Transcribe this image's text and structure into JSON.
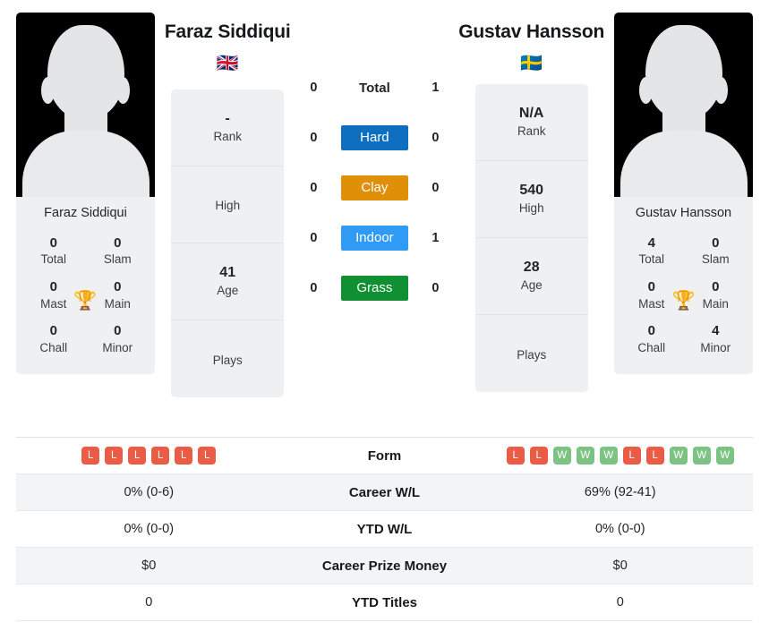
{
  "players": {
    "left": {
      "name": "Faraz Siddiqui",
      "flag": "🇬🇧",
      "photo_caption": "Faraz Siddiqui",
      "rank": "-",
      "rank_label": "Rank",
      "high": "",
      "high_label": "High",
      "age": "41",
      "age_label": "Age",
      "plays": "",
      "plays_label": "Plays",
      "titles": [
        {
          "value": "0",
          "label": "Total"
        },
        {
          "value": "0",
          "label": "Slam"
        },
        {
          "value": "0",
          "label": "Mast"
        },
        {
          "value": "0",
          "label": "Main"
        },
        {
          "value": "0",
          "label": "Chall"
        },
        {
          "value": "0",
          "label": "Minor"
        }
      ],
      "form": [
        "L",
        "L",
        "L",
        "L",
        "L",
        "L"
      ]
    },
    "right": {
      "name": "Gustav Hansson",
      "flag": "🇸🇪",
      "photo_caption": "Gustav Hansson",
      "rank": "N/A",
      "rank_label": "Rank",
      "high": "540",
      "high_label": "High",
      "age": "28",
      "age_label": "Age",
      "plays": "",
      "plays_label": "Plays",
      "titles": [
        {
          "value": "4",
          "label": "Total"
        },
        {
          "value": "0",
          "label": "Slam"
        },
        {
          "value": "0",
          "label": "Mast"
        },
        {
          "value": "0",
          "label": "Main"
        },
        {
          "value": "0",
          "label": "Chall"
        },
        {
          "value": "4",
          "label": "Minor"
        }
      ],
      "form": [
        "L",
        "L",
        "W",
        "W",
        "W",
        "L",
        "L",
        "W",
        "W",
        "W"
      ]
    }
  },
  "trophy_icon": "🏆",
  "head_to_head": [
    {
      "label": "Total",
      "left": "0",
      "right": "1",
      "color": ""
    },
    {
      "label": "Hard",
      "left": "0",
      "right": "0",
      "color": "#0e6fc0"
    },
    {
      "label": "Clay",
      "left": "0",
      "right": "0",
      "color": "#df8f08"
    },
    {
      "label": "Indoor",
      "left": "0",
      "right": "1",
      "color": "#2f9bf5"
    },
    {
      "label": "Grass",
      "left": "0",
      "right": "0",
      "color": "#119033"
    }
  ],
  "stats": [
    {
      "label": "Form",
      "left": "",
      "right": "",
      "type": "form"
    },
    {
      "label": "Career W/L",
      "left": "0% (0-6)",
      "right": "69% (92-41)",
      "type": "text"
    },
    {
      "label": "YTD W/L",
      "left": "0% (0-0)",
      "right": "0% (0-0)",
      "type": "text"
    },
    {
      "label": "Career Prize Money",
      "left": "$0",
      "right": "$0",
      "type": "text"
    },
    {
      "label": "YTD Titles",
      "left": "0",
      "right": "0",
      "type": "text"
    }
  ]
}
